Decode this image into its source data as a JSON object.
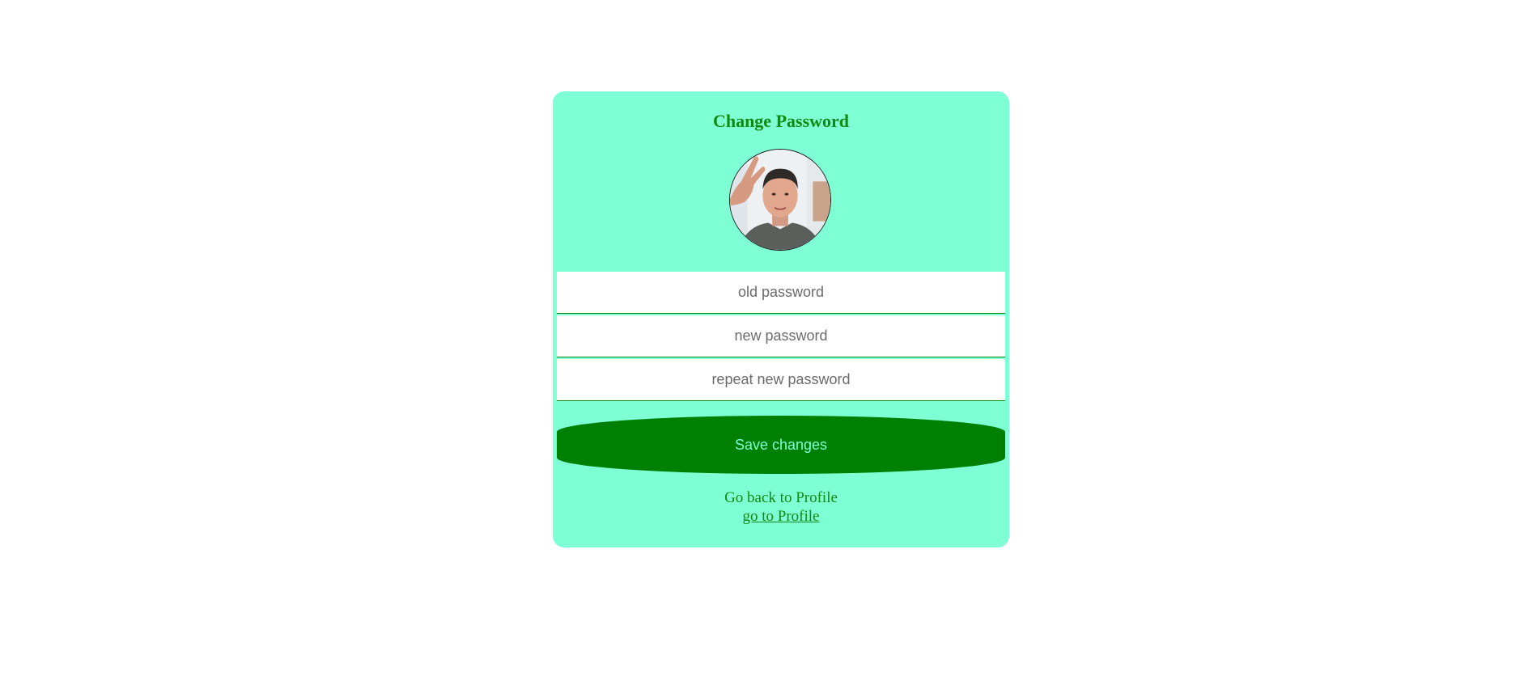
{
  "card": {
    "title": "Change Password",
    "avatar_alt": "user profile photo"
  },
  "form": {
    "old_password_placeholder": "old password",
    "new_password_placeholder": "new password",
    "repeat_password_placeholder": "repeat new password",
    "save_label": "Save changes"
  },
  "footer": {
    "back_text": "Go back to Profile",
    "link_label": "go to Profile"
  },
  "colors": {
    "card_background": "#7fffd4",
    "accent_green": "#008000",
    "text_green": "#138a13"
  }
}
